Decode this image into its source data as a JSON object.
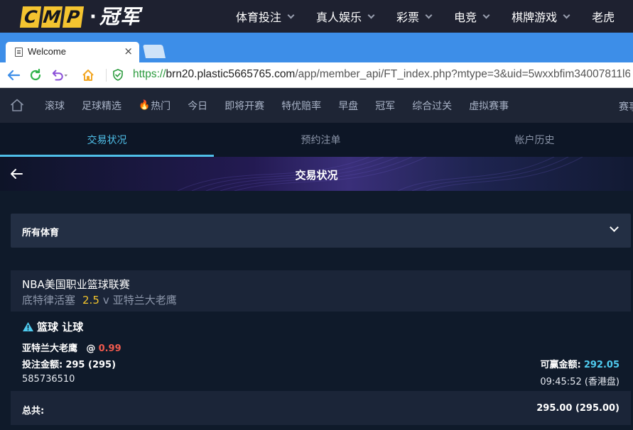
{
  "site": {
    "logo_letters": [
      "C",
      "M",
      "P"
    ],
    "logo_word": "冠军",
    "nav": [
      {
        "label": "体育投注"
      },
      {
        "label": "真人娱乐"
      },
      {
        "label": "彩票"
      },
      {
        "label": "电竞"
      },
      {
        "label": "棋牌游戏"
      },
      {
        "label": "老虎"
      }
    ]
  },
  "browser": {
    "tab_title": "Welcome",
    "tab_close": "×",
    "url_scheme": "https://",
    "url_host": "brn20.plastic5665765.com",
    "url_path": "/app/member_api/FT_index.php?mtype=3&uid=5wxxbfim34007811l643"
  },
  "sports_nav": {
    "items": [
      {
        "label": "滚球"
      },
      {
        "label": "足球精选"
      },
      {
        "label": "热门",
        "icon": "fire-icon"
      },
      {
        "label": "今日"
      },
      {
        "label": "即将开赛"
      },
      {
        "label": "特优赔率"
      },
      {
        "label": "早盘"
      },
      {
        "label": "冠军"
      },
      {
        "label": "综合过关"
      },
      {
        "label": "虚拟赛事"
      }
    ],
    "last_item": "赛事"
  },
  "sub_tabs": [
    {
      "label": "交易状况",
      "active": true
    },
    {
      "label": "预约注单",
      "active": false
    },
    {
      "label": "帐户历史",
      "active": false
    }
  ],
  "banner": {
    "title": "交易状况"
  },
  "filter": {
    "selected": "所有体育"
  },
  "bet": {
    "league": "NBA美国职业篮球联赛",
    "home_team": "底特律活塞",
    "handicap": "2.5",
    "vs": "v",
    "away_team": "亚特兰大老鹰",
    "bet_type": "篮球 让球",
    "selection": "亚特兰大老鹰",
    "odds_prefix": "@",
    "odds": "0.99",
    "stake_label": "投注金额:",
    "stake_value": "295 (295)",
    "win_label": "可赢金额:",
    "win_value": "292.05",
    "ticket_id": "585736510",
    "time": "09:45:52 (香港盘)"
  },
  "total": {
    "label": "总共:",
    "value": "295.00 (295.00)"
  },
  "colors": {
    "accent": "#4fbfe8",
    "logo_yellow": "#f4c430",
    "odds_red": "#ef5a4e",
    "handicap_yellow": "#f2c42c",
    "win_cyan": "#4fcbef",
    "browser_blue": "#3d8ee8"
  }
}
